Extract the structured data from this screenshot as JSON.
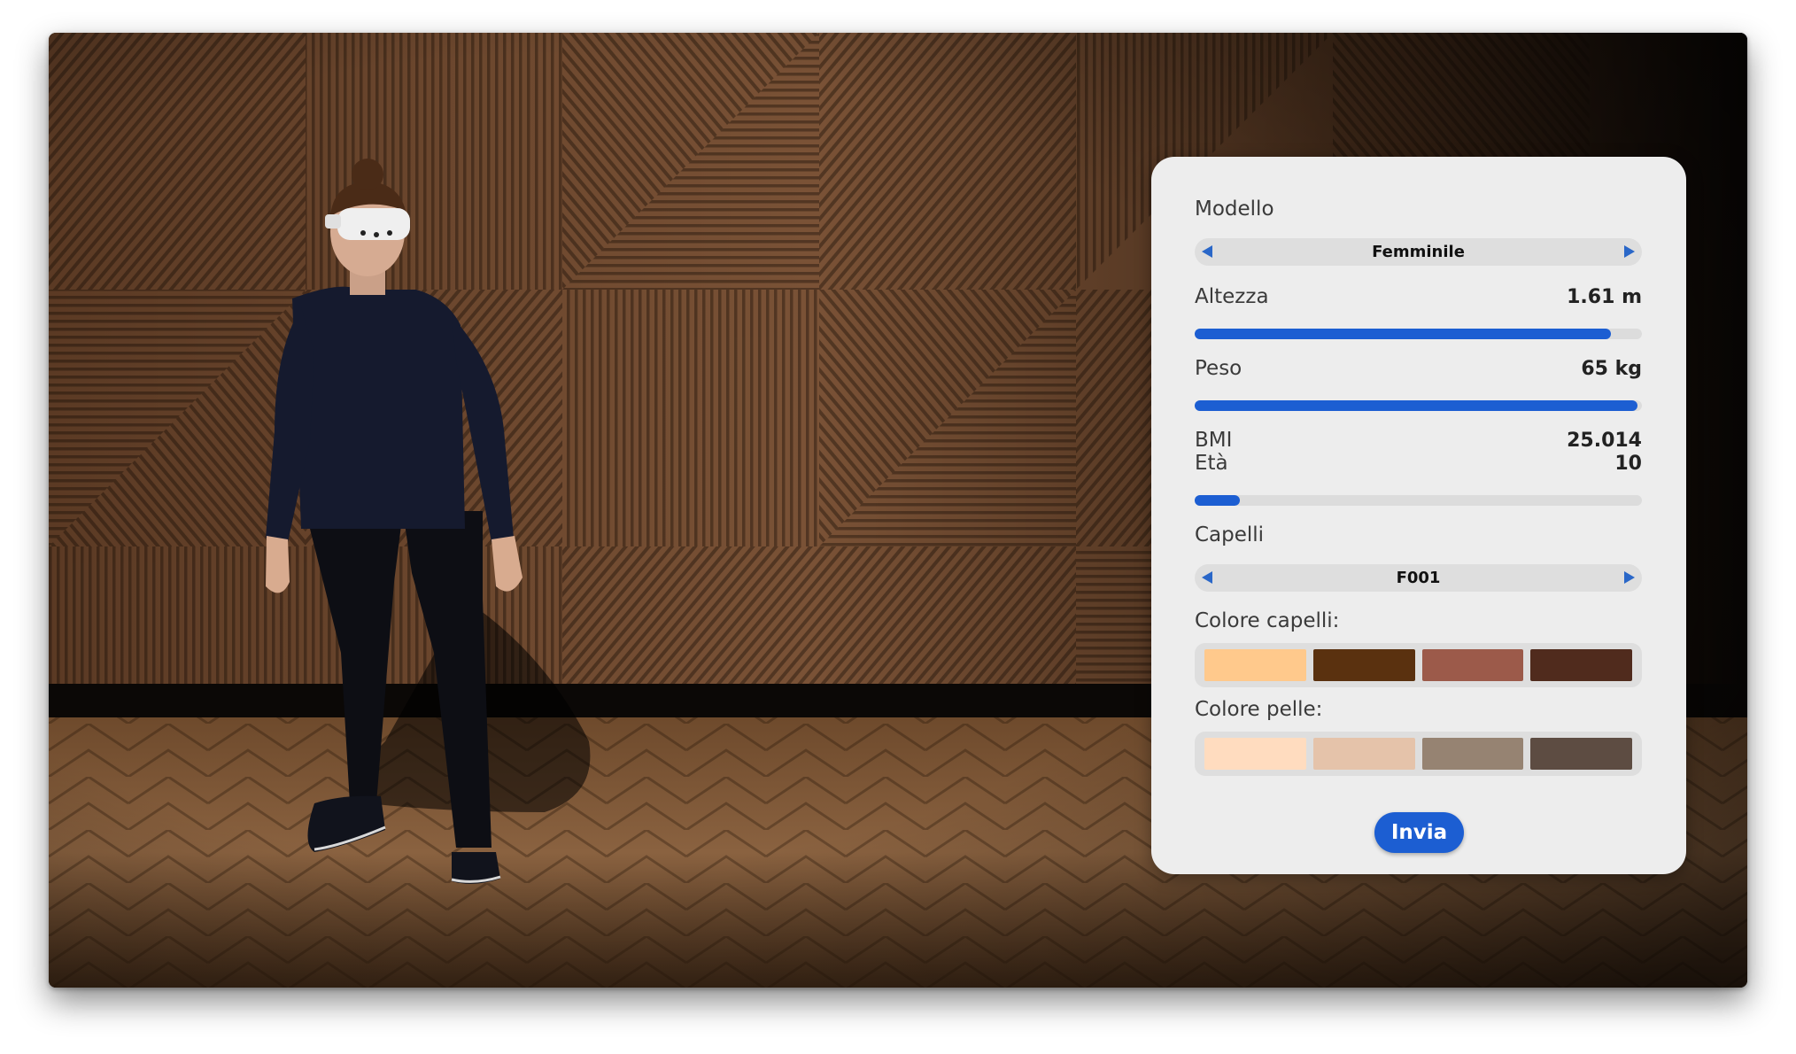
{
  "panel": {
    "model": {
      "label": "Modello",
      "value": "Femminile"
    },
    "height": {
      "label": "Altezza",
      "value": "1.61 m",
      "fill": 0.93
    },
    "weight": {
      "label": "Peso",
      "value": "65 kg",
      "fill": 0.99
    },
    "bmi": {
      "label": "BMI",
      "value": "25.014"
    },
    "age": {
      "label": "Età",
      "value": "10",
      "fill": 0.1
    },
    "hair": {
      "label": "Capelli",
      "value": "F001"
    },
    "hair_color": {
      "label": "Colore capelli:",
      "swatches": [
        "#ffc98c",
        "#5a310f",
        "#9c5a4a",
        "#502b1d"
      ]
    },
    "skin_color": {
      "label": "Colore pelle:",
      "swatches": [
        "#ffdcbf",
        "#e5c3aa",
        "#968372",
        "#5d4c42"
      ]
    },
    "submit_label": "Invia"
  },
  "colors": {
    "accent": "#1c5ed2",
    "panel_bg": "#ededed"
  }
}
